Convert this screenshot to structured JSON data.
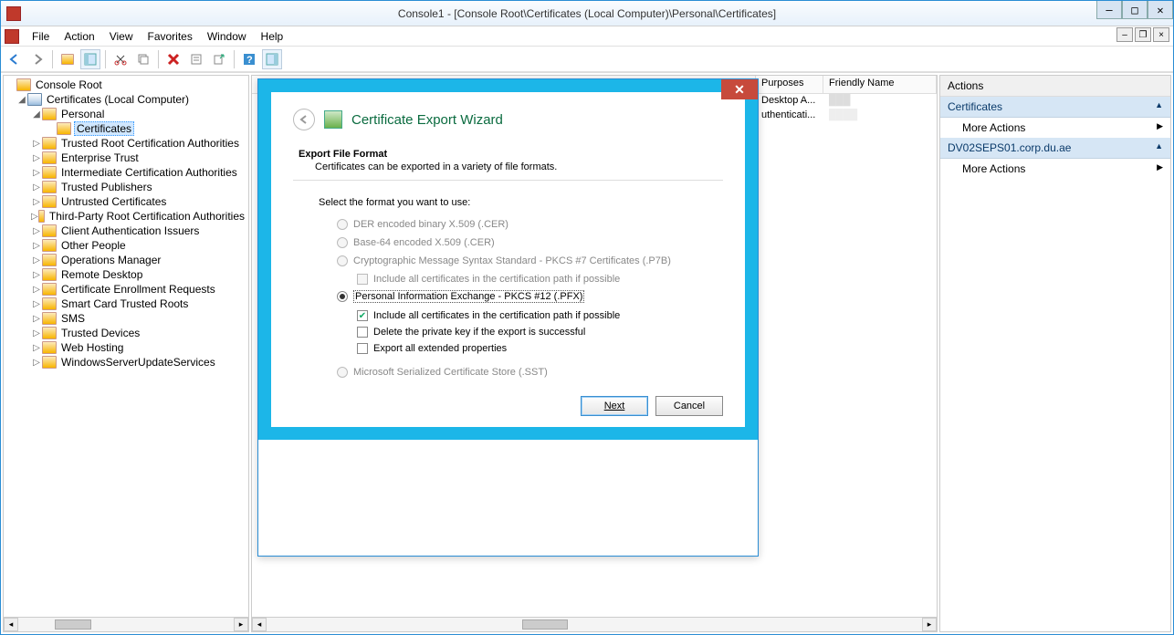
{
  "window": {
    "title": "Console1 - [Console Root\\Certificates (Local Computer)\\Personal\\Certificates]"
  },
  "menu": {
    "file": "File",
    "action": "Action",
    "view": "View",
    "favorites": "Favorites",
    "window": "Window",
    "help": "Help"
  },
  "tree": {
    "root": "Console Root",
    "certs": "Certificates (Local Computer)",
    "personal": "Personal",
    "personal_certs": "Certificates",
    "nodes": [
      "Trusted Root Certification Authorities",
      "Enterprise Trust",
      "Intermediate Certification Authorities",
      "Trusted Publishers",
      "Untrusted Certificates",
      "Third-Party Root Certification Authorities",
      "Client Authentication Issuers",
      "Other People",
      "Operations Manager",
      "Remote Desktop",
      "Certificate Enrollment Requests",
      "Smart Card Trusted Roots",
      "SMS",
      "Trusted Devices",
      "Web Hosting",
      "WindowsServerUpdateServices"
    ]
  },
  "list": {
    "col_purposes": "Purposes",
    "col_friendly": "Friendly Name",
    "row1_purposes": "Desktop A...",
    "row2_purposes": "uthenticati..."
  },
  "actions": {
    "header": "Actions",
    "section1": "Certificates",
    "more1": "More Actions",
    "section2": "DV02SEPS01.corp.du.ae",
    "more2": "More Actions"
  },
  "wizard": {
    "title": "Certificate Export Wizard",
    "section_title": "Export File Format",
    "section_sub": "Certificates can be exported in a variety of file formats.",
    "prompt": "Select the format you want to use:",
    "opt_der": "DER encoded binary X.509 (.CER)",
    "opt_base64": "Base-64 encoded X.509 (.CER)",
    "opt_p7b": "Cryptographic Message Syntax Standard - PKCS #7 Certificates (.P7B)",
    "opt_p7b_chk": "Include all certificates in the certification path if possible",
    "opt_pfx": "Personal Information Exchange - PKCS #12 (.PFX)",
    "opt_pfx_chk1": "Include all certificates in the certification path if possible",
    "opt_pfx_chk2": "Delete the private key if the export is successful",
    "opt_pfx_chk3": "Export all extended properties",
    "opt_sst": "Microsoft Serialized Certificate Store (.SST)",
    "btn_next": "Next",
    "btn_cancel": "Cancel"
  }
}
